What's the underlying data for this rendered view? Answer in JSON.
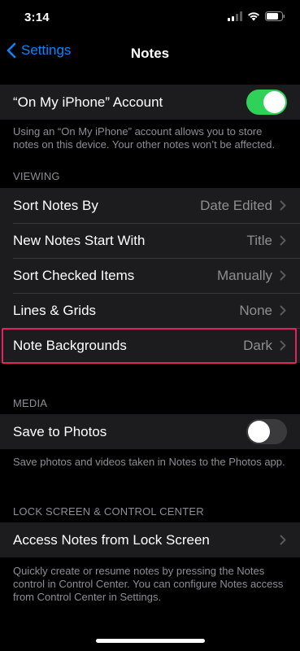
{
  "status": {
    "time": "3:14"
  },
  "nav": {
    "back_label": "Settings",
    "title": "Notes"
  },
  "account": {
    "label": "“On My iPhone” Account",
    "toggle_on": true,
    "footer": "Using an “On My iPhone” account allows you to store notes on this device. Your other notes won’t be affected."
  },
  "viewing": {
    "header": "VIEWING",
    "rows": [
      {
        "label": "Sort Notes By",
        "value": "Date Edited"
      },
      {
        "label": "New Notes Start With",
        "value": "Title"
      },
      {
        "label": "Sort Checked Items",
        "value": "Manually"
      },
      {
        "label": "Lines & Grids",
        "value": "None"
      },
      {
        "label": "Note Backgrounds",
        "value": "Dark"
      }
    ]
  },
  "media": {
    "header": "MEDIA",
    "label": "Save to Photos",
    "toggle_on": false,
    "footer": "Save photos and videos taken in Notes to the Photos app."
  },
  "lock": {
    "header": "LOCK SCREEN & CONTROL CENTER",
    "label": "Access Notes from Lock Screen",
    "footer": "Quickly create or resume notes by pressing the Notes control in Control Center. You can configure Notes access from Control Center in Settings."
  },
  "colors": {
    "accent": "#0a84ff",
    "toggle_on": "#30d158",
    "highlight": "#e0245e",
    "cell_bg": "#1c1c1e"
  }
}
